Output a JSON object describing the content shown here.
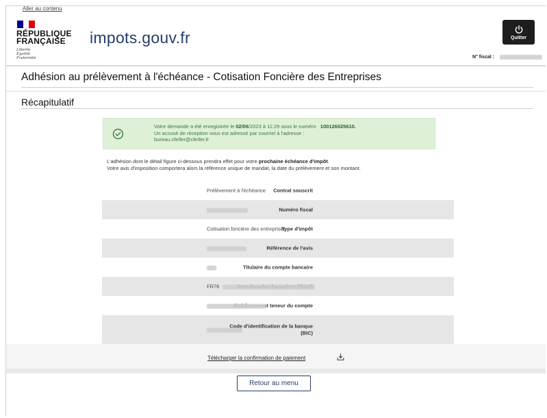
{
  "header": {
    "skip_link": "Aller au contenu",
    "republic_line1": "RÉPUBLIQUE",
    "republic_line2": "FRANÇAISE",
    "devise": [
      "Liberté",
      "Égalité",
      "Fraternité"
    ],
    "site_name_part1": "impots",
    "site_name_dot": ".",
    "site_name_part2": "gouv.fr",
    "quit_label": "Quitter",
    "fiscal_label": "N° fiscal :"
  },
  "page": {
    "title": "Adhésion au prélèvement à l'échéance - Cotisation Foncière des Entreprises",
    "section_title": "Récapitulatif"
  },
  "alert": {
    "line1_pre": "Votre demande a été enregistrée le ",
    "line1_date": "02/06",
    "line1_mid": "/2023 à 11:29 sous le numéro ",
    "line1_number": "100126025610.",
    "line2": "Un accusé de réception vous est adressé par courriel à l'adresse :",
    "line3": "bureau.cfeifer@cfeifer.fr"
  },
  "info": {
    "line1_pre": "L'adhésion dont le détail figure ci-dessous prendra effet pour votre ",
    "line1_bold": "prochaine échéance d'impôt",
    "line1_post": ".",
    "line2": "Votre avis d'imposition comportera alors la référence unique de mandat, la date du prélèvement et son montant."
  },
  "summary": [
    {
      "label": "Contrat souscrit",
      "value": "Prélèvement à l'échéance",
      "redacted": false
    },
    {
      "label": "Numéro fiscal",
      "value": "",
      "redacted": true
    },
    {
      "label": "Type d'impôt",
      "value": "Cotisation foncière des entreprises",
      "redacted": false
    },
    {
      "label": "Référence de l'avis",
      "value": "",
      "redacted": true
    },
    {
      "label": "Titulaire du compte bancaire",
      "value": "",
      "redacted": true
    },
    {
      "label": "Coordonnées bancaires (IBAN)",
      "value": "FR76",
      "redacted": true
    },
    {
      "label": "Etablissement teneur du compte",
      "value": "",
      "redacted": true
    },
    {
      "label": "Code d'identification de la banque (BIC)",
      "value": "",
      "redacted": true
    }
  ],
  "actions": {
    "download_label": "Télécharger la confirmation de paiement",
    "back_label": "Retour au menu"
  },
  "colors": {
    "flag_blue": "#000091",
    "flag_white": "#ffffff",
    "flag_red": "#e1000f",
    "brand_navy": "#243e6a",
    "success_bg": "#dff0d8",
    "success_text": "#3c763d",
    "row_alt_bg": "#e6e6e6"
  }
}
